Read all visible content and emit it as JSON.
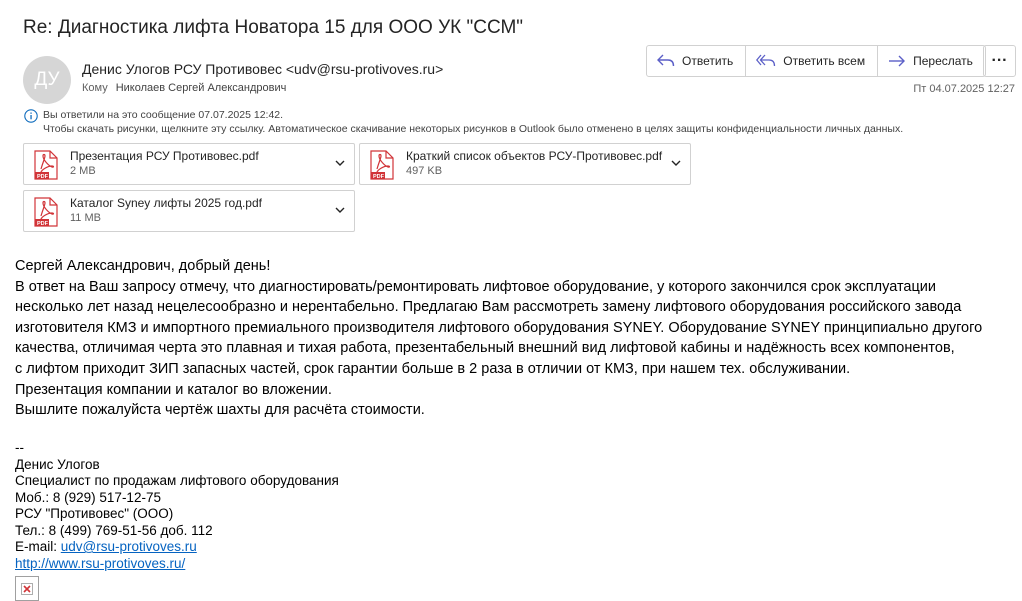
{
  "subject": "Re: Диагностика лифта Новатора 15 для ООО УК \"ССМ\"",
  "sender": {
    "initials": "ДУ",
    "display": "Денис Улогов РСУ Противовес <udv@rsu-protivoves.ru>",
    "to_label": "Кому",
    "to_value": "Николаев Сергей Александрович",
    "date": "Пт 04.07.2025 12:27"
  },
  "actions": {
    "reply": "Ответить",
    "reply_all": "Ответить всем",
    "forward": "Переслать",
    "more": "···"
  },
  "info": {
    "line1": "Вы ответили на это сообщение 07.07.2025 12:42.",
    "line2": "Чтобы скачать рисунки, щелкните эту ссылку. Автоматическое скачивание некоторых рисунков в Outlook было отменено в целях защиты конфиденциальности личных данных."
  },
  "attachments": [
    {
      "name": "Презентация  РСУ  Противовес.pdf",
      "size": "2 MB",
      "icon": "pdf-icon"
    },
    {
      "name": "Краткий список объектов РСУ-Противовес.pdf",
      "size": "497 KB",
      "icon": "pdf-icon"
    },
    {
      "name": "Каталог Syney лифты 2025 год.pdf",
      "size": "11 MB",
      "icon": "pdf-icon"
    }
  ],
  "body": {
    "lines": [
      "Сергей Александрович, добрый день!",
      "В ответ на Ваш запросу отмечу, что диагностировать/ремонтировать лифтовое оборудование, у которого закончился срок эксплуатации",
      "несколько лет назад нецелесообразно и нерентабельно. Предлагаю Вам рассмотреть замену лифтового оборудования российского завода",
      "изготовителя КМЗ и импортного премиального производителя лифтового оборудования SYNEY. Оборудование SYNEY принципиально другого",
      "качества, отличимая черта это плавная и тихая работа, презентабельный внешний вид лифтовой кабины и надёжность всех компонентов,",
      "с лифтом приходит ЗИП запасных частей, срок гарантии больше в 2 раза в отличии от КМЗ, при нашем тех. обслуживании.",
      "Презентация компании и каталог во вложении.",
      "Вышлите пожалуйста чертёж шахты для расчёта стоимости."
    ]
  },
  "signature": {
    "separator": "--",
    "name": "Денис Улогов",
    "position": "Специалист по продажам лифтового оборудования",
    "mobile": "Моб.: 8 (929) 517-12-75",
    "company": "РСУ \"Противовес\" (ООО)",
    "phone": "Тел.: 8 (499) 769-51-56 доб. 112",
    "email_label": "E-mail: ",
    "email": "udv@rsu-protivoves.ru",
    "website": "http://www.rsu-protivoves.ru/"
  },
  "colors": {
    "accent": "#5b5fc7",
    "pdf_red": "#d13438",
    "link": "#0563c1"
  }
}
